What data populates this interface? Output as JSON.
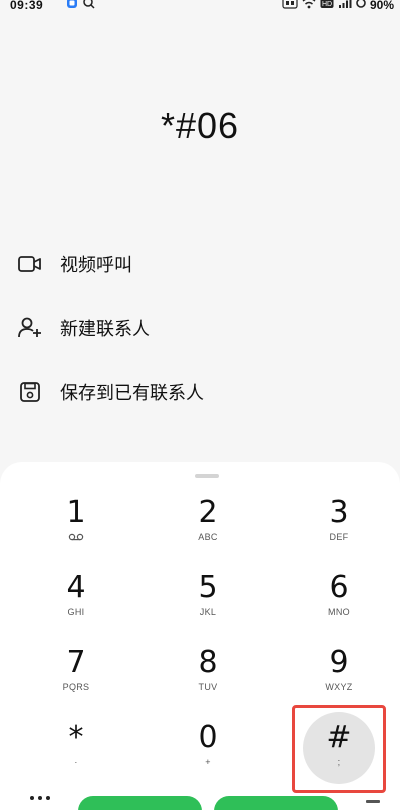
{
  "status_bar": {
    "time": "09:39",
    "battery": "90%",
    "left_icons": [
      "app-notification-icon",
      "cloud-sync-icon"
    ],
    "right_icons": [
      "nfc-icon",
      "wifi-icon",
      "hd-icon",
      "signal-icon",
      "battery-icon"
    ]
  },
  "dialed_number": "*#06",
  "actions": [
    {
      "label": "视频呼叫",
      "icon": "video-call-icon"
    },
    {
      "label": "新建联系人",
      "icon": "add-contact-icon"
    },
    {
      "label": "保存到已有联系人",
      "icon": "save-icon"
    }
  ],
  "keypad": {
    "keys": [
      {
        "digit": "1",
        "letters": "",
        "icon": "voicemail-icon"
      },
      {
        "digit": "2",
        "letters": "ABC"
      },
      {
        "digit": "3",
        "letters": "DEF"
      },
      {
        "digit": "4",
        "letters": "GHI"
      },
      {
        "digit": "5",
        "letters": "JKL"
      },
      {
        "digit": "6",
        "letters": "MNO"
      },
      {
        "digit": "7",
        "letters": "PQRS"
      },
      {
        "digit": "8",
        "letters": "TUV"
      },
      {
        "digit": "9",
        "letters": "WXYZ"
      },
      {
        "digit": "*",
        "letters": "·"
      },
      {
        "digit": "0",
        "letters": "+"
      },
      {
        "digit": "#",
        "letters": ";"
      }
    ]
  },
  "highlight_color": "#e8473e",
  "call_button_color": "#2fbf58"
}
